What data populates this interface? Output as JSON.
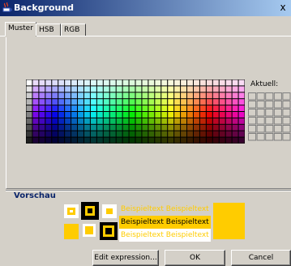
{
  "window": {
    "title": "Background",
    "close_glyph": "x",
    "icon": "java-cup-icon"
  },
  "tabs": [
    {
      "label": "Muster",
      "active": true
    },
    {
      "label": "HSB",
      "active": false
    },
    {
      "label": "RGB",
      "active": false
    }
  ],
  "palette": {
    "current_label": "Aktuell:"
  },
  "preview": {
    "title": "Vorschau",
    "accent_color": "#ffcc00",
    "text_rows": [
      {
        "text": "Beispieltext  Beispieltext",
        "fg": "#ffcc00",
        "bg": "#d4d0c8"
      },
      {
        "text": "Beispieltext  Beispieltext",
        "fg": "#000000",
        "bg": "#ffcc00"
      },
      {
        "text": "Beispieltext  Beispieltext",
        "fg": "#ffcc00",
        "bg": "#ffffff"
      }
    ]
  },
  "buttons": {
    "edit": "Edit expression...",
    "ok": "OK",
    "cancel": "Cancel"
  }
}
